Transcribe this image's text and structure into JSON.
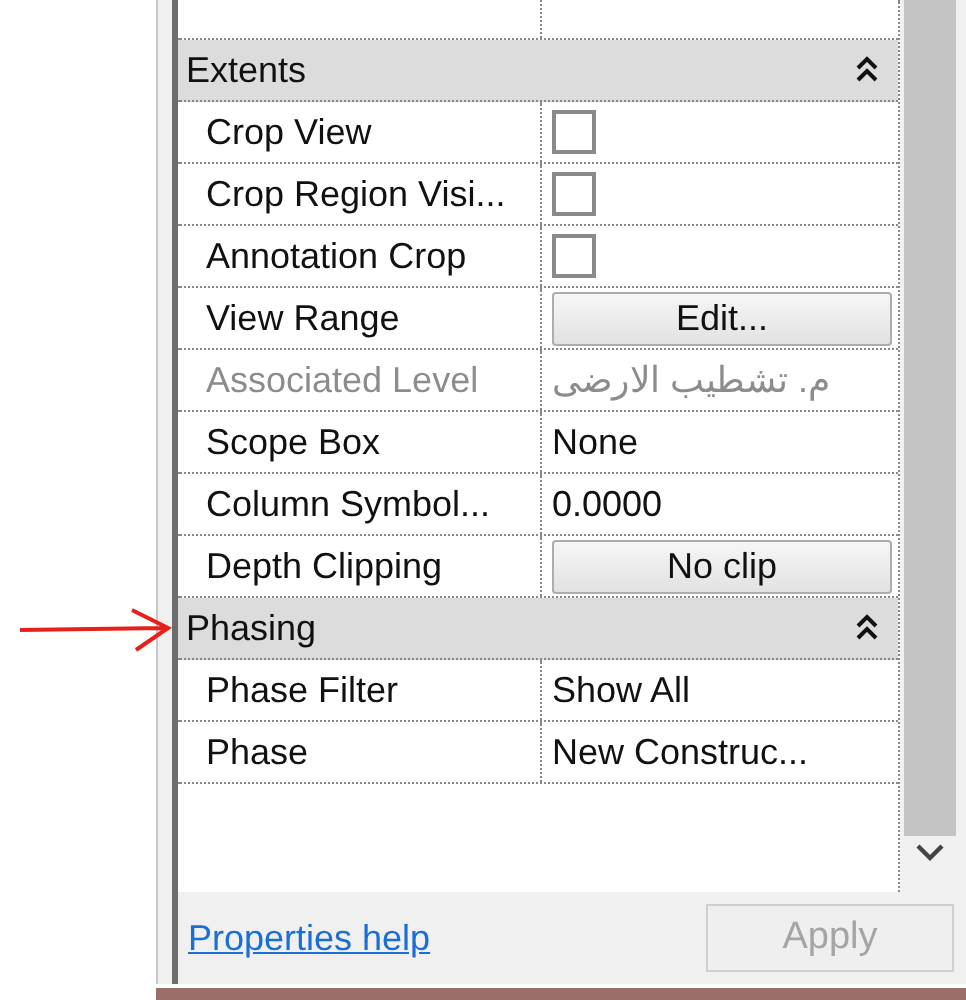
{
  "sections": [
    {
      "title": "Extents",
      "expanded": true,
      "rows": [
        {
          "label": "Crop View",
          "kind": "checkbox",
          "checked": false
        },
        {
          "label": "Crop Region Visi...",
          "kind": "checkbox",
          "checked": false
        },
        {
          "label": "Annotation Crop",
          "kind": "checkbox",
          "checked": false
        },
        {
          "label": "View Range",
          "kind": "button",
          "value": "Edit..."
        },
        {
          "label": "Associated Level",
          "kind": "text",
          "value": "م. تشطيب الارضى",
          "disabled": true
        },
        {
          "label": "Scope Box",
          "kind": "text",
          "value": "None",
          "disabled": false
        },
        {
          "label": "Column Symbol...",
          "kind": "text",
          "value": "0.0000",
          "disabled": false
        },
        {
          "label": "Depth Clipping",
          "kind": "button",
          "value": "No clip"
        }
      ]
    },
    {
      "title": "Phasing",
      "expanded": true,
      "rows": [
        {
          "label": "Phase Filter",
          "kind": "text",
          "value": "Show All",
          "disabled": false
        },
        {
          "label": "Phase",
          "kind": "text",
          "value": "New Construc...",
          "disabled": false
        }
      ]
    }
  ],
  "footer": {
    "help_link": "Properties help",
    "apply_button": {
      "label": "Apply",
      "disabled": true
    }
  }
}
